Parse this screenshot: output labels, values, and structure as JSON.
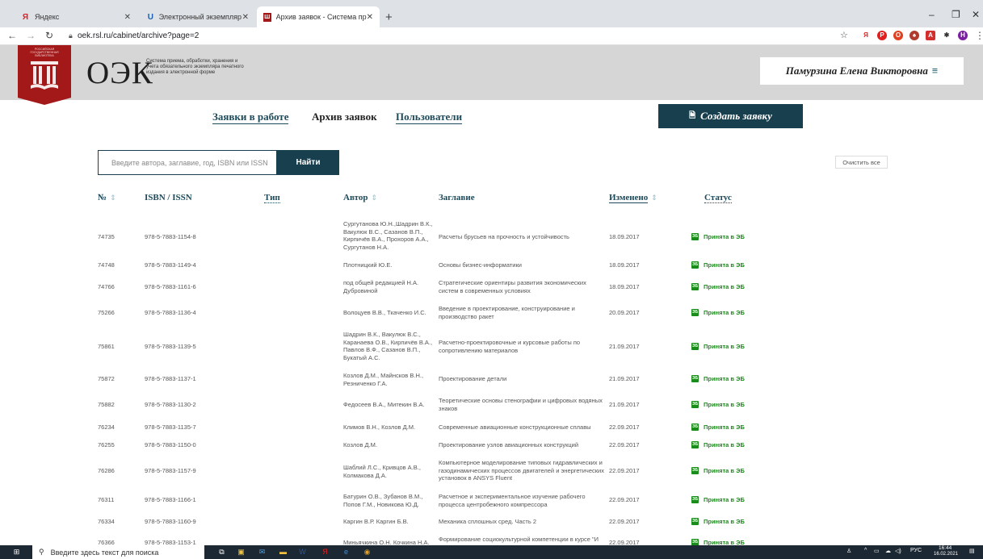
{
  "browser": {
    "tabs": [
      {
        "title": "Яндекс",
        "icon": "yandex-icon"
      },
      {
        "title": "Электронный экземпляр - Личн",
        "icon": "rsl-icon"
      },
      {
        "title": "Архив заявок - Система приём",
        "icon": "oek-icon"
      }
    ],
    "url": "oek.rsl.ru/cabinet/archive?page=2"
  },
  "header": {
    "badge_text": "РОССИЙСКАЯ ГОСУДАРСТВЕННАЯ БИБЛИОТЕКА",
    "brand": "ОЭК",
    "tagline": "Система приема, обработки, хранения и учета обязательного экземпляра печатного издания в электронной форме",
    "user_name": "Памурзина Елена Викторовна"
  },
  "nav": {
    "in_work": "Заявки в работе",
    "archive": "Архив заявок",
    "users": "Пользователи",
    "create": "Создать заявку"
  },
  "search": {
    "placeholder": "Введите автора, заглавие, год, ISBN или ISSN",
    "button": "Найти",
    "clear": "Очистить все"
  },
  "table": {
    "headers": {
      "no": "№",
      "isbn": "ISBN / ISSN",
      "type": "Тип",
      "author": "Автор",
      "title": "Заглавие",
      "changed": "Изменено",
      "status": "Статус"
    },
    "rows": [
      {
        "no": "74735",
        "isbn": "978-5-7883-1154-8",
        "author": "Сургутанова Ю.Н.,Шадрин В.К., Вакулюк В.С., Сазанов В.П., Кирпичёв В.А., Прохоров А.А., Сургутанов Н.А.",
        "title": "Расчеты брусьев на прочность и устойчивость",
        "date": "18.09.2017",
        "status": "Принята в ЭБ"
      },
      {
        "no": "74748",
        "isbn": "978-5-7883-1149-4",
        "author": "Плотницкий Ю.Е.",
        "title": "Основы бизнес-информатики",
        "date": "18.09.2017",
        "status": "Принята в ЭБ"
      },
      {
        "no": "74766",
        "isbn": "978-5-7883-1161-6",
        "author": "под общей редакцией Н.А. Дубровиной",
        "title": "Стратегические ориентиры развития экономических систем в современных условиях",
        "date": "18.09.2017",
        "status": "Принята в ЭБ"
      },
      {
        "no": "75266",
        "isbn": "978-5-7883-1136-4",
        "author": "Волоцуев В.В., Ткаченко И.С.",
        "title": "Введение в проектирование, конструирование и производство ракет",
        "date": "20.09.2017",
        "status": "Принята в ЭБ"
      },
      {
        "no": "75861",
        "isbn": "978-5-7883-1139-5",
        "author": "Шадрин В.К., Вакулюк В.С., Каранаева О.В., Кирпичёв В.А., Павлов В.Ф., Сазанов В.П., Букатый А.С.",
        "title": "Расчетно-проектировочные и курсовые работы по сопротивлению материалов",
        "date": "21.09.2017",
        "status": "Принята в ЭБ"
      },
      {
        "no": "75872",
        "isbn": "978-5-7883-1137-1",
        "author": "Козлов Д.М., Майнсков В.Н., Резниченко Г.А.",
        "title": "Проектирование детали",
        "date": "21.09.2017",
        "status": "Принята в ЭБ"
      },
      {
        "no": "75882",
        "isbn": "978-5-7883-1130-2",
        "author": "Федосеев В.А., Митекин В.А.",
        "title": "Теоретические основы стенографии и цифровых водяных знаков",
        "date": "21.09.2017",
        "status": "Принята в ЭБ"
      },
      {
        "no": "76234",
        "isbn": "978-5-7883-1135-7",
        "author": "Климов В.Н., Козлов Д.М.",
        "title": "Современные авиационные конструкционные сплавы",
        "date": "22.09.2017",
        "status": "Принята в ЭБ"
      },
      {
        "no": "76255",
        "isbn": "978-5-7883-1150-0",
        "author": "Козлов Д.М.",
        "title": "Проектирование узлов авиационных конструкций",
        "date": "22.09.2017",
        "status": "Принята в ЭБ"
      },
      {
        "no": "76286",
        "isbn": "978-5-7883-1157-9",
        "author": "Шаблий Л.С., Кривцов А.В., Колмакова Д.А.",
        "title": "Компьютерное моделирование типовых гидравлических и газодинамических процессов двигателей и энергетических установок в ANSYS Fluent",
        "date": "22.09.2017",
        "status": "Принята в ЭБ"
      },
      {
        "no": "76311",
        "isbn": "978-5-7883-1166-1",
        "author": "Батурин О.В., Зубанов В.М., Попов Г.М., Новикова Ю.Д.",
        "title": "Расчетное и экспериментальное изучение рабочего процесса центробежного компрессора",
        "date": "22.09.2017",
        "status": "Принята в ЭБ"
      },
      {
        "no": "76334",
        "isbn": "978-5-7883-1160-9",
        "author": "Каргин В.Р. Каргин Б.В.",
        "title": "Механика сплошных сред. Часть 2",
        "date": "22.09.2017",
        "status": "Принята в ЭБ"
      },
      {
        "no": "76366",
        "isbn": "978-5-7883-1153-1",
        "author": "Миньячкина О.Н. Кочкина Н.А.",
        "title": "Формирование социокультурной компетенции в курсе \"И",
        "date": "22.09.2017",
        "status": "Принята в ЭБ"
      }
    ]
  },
  "taskbar": {
    "search_placeholder": "Введите здесь текст для поиска",
    "lang": "РУС",
    "time": "16:44",
    "date": "16.02.2021"
  }
}
